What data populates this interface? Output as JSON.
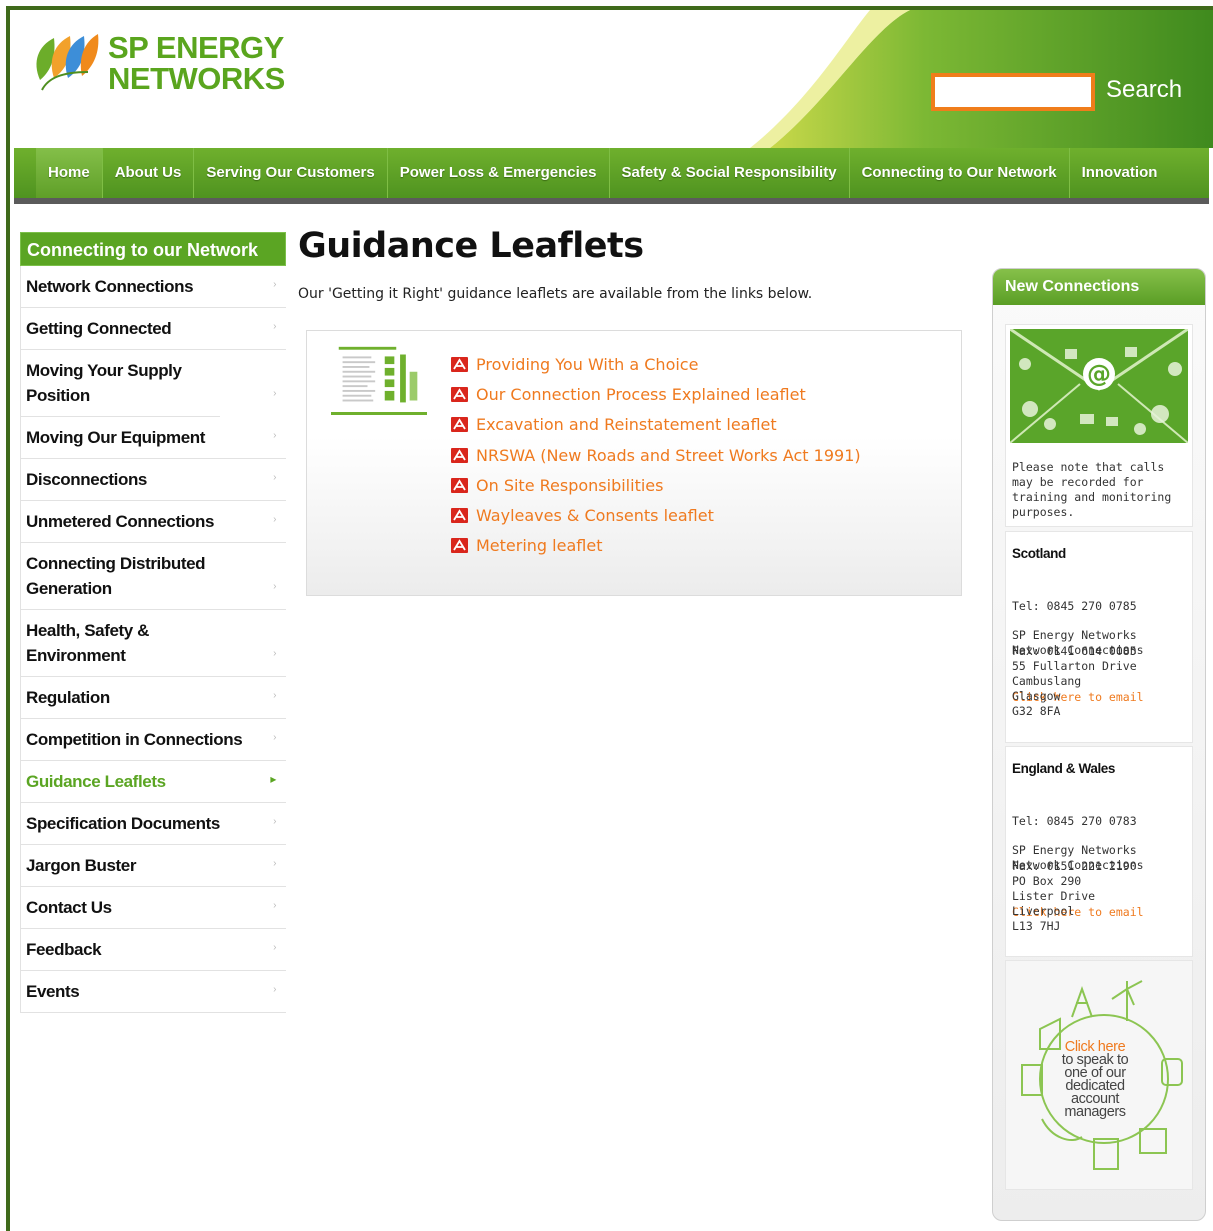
{
  "brand": {
    "name_line1": "SP ENERGY",
    "name_line2": "NETWORKS"
  },
  "search": {
    "value": "",
    "button": "Search"
  },
  "nav": {
    "items": [
      "Home",
      "About Us",
      "Serving Our Customers",
      "Power Loss & Emergencies",
      "Safety & Social Responsibility",
      "Connecting to Our Network",
      "Innovation"
    ]
  },
  "sidebar": {
    "title": "Connecting to our Network",
    "items": [
      "Network Connections",
      "Getting Connected",
      "Moving Your Supply Position",
      "Moving Our Equipment",
      "Disconnections",
      "Unmetered Connections",
      "Connecting Distributed Generation",
      "Health, Safety & Environment",
      "Regulation",
      "Competition in Connections",
      "Guidance Leaflets",
      "Specification Documents",
      "Jargon Buster",
      "Contact Us",
      "Feedback",
      "Events"
    ],
    "current": "Guidance Leaflets"
  },
  "main": {
    "title": "Guidance Leaflets",
    "intro": "Our 'Getting it Right' guidance leaflets are available from the links below.",
    "leaflets": [
      "Providing You With a Choice",
      "Our Connection Process Explained leaflet",
      "Excavation and Reinstatement leaflet",
      "NRSWA (New Roads and Street Works Act 1991)",
      "On Site Responsibilities",
      "Wayleaves & Consents leaflet",
      "Metering leaflet"
    ]
  },
  "right": {
    "title": "New Connections",
    "note": "Please note that calls may be recorded for training and monitoring purposes.",
    "scotland": {
      "name": "Scotland",
      "tel": "Tel: 0845 270 0785",
      "fax": "Fax: 0141 614 0085",
      "email": "Click here to email",
      "address": [
        "SP Energy Networks",
        "Network Connections",
        "55 Fullarton Drive",
        "Cambuslang",
        "Glasgow",
        "G32 8FA"
      ]
    },
    "england": {
      "name": "England & Wales",
      "tel": "Tel: 0845 270 0783",
      "fax": "Fax: 0151 221 2190",
      "email": "Click here to email",
      "address": [
        "SP Energy Networks",
        "Network Connections",
        "PO Box 290",
        "Lister Drive",
        "Liverpool",
        "L13 7HJ"
      ]
    },
    "cta": {
      "click": "Click here",
      "line2": "to speak to",
      "line3": "one of our",
      "line4": "dedicated",
      "line5": "account",
      "line6": "managers"
    }
  },
  "colors": {
    "brand_green": "#5ba523",
    "accent_orange": "#ef7a1f",
    "frame_green": "#3f6a1b"
  }
}
